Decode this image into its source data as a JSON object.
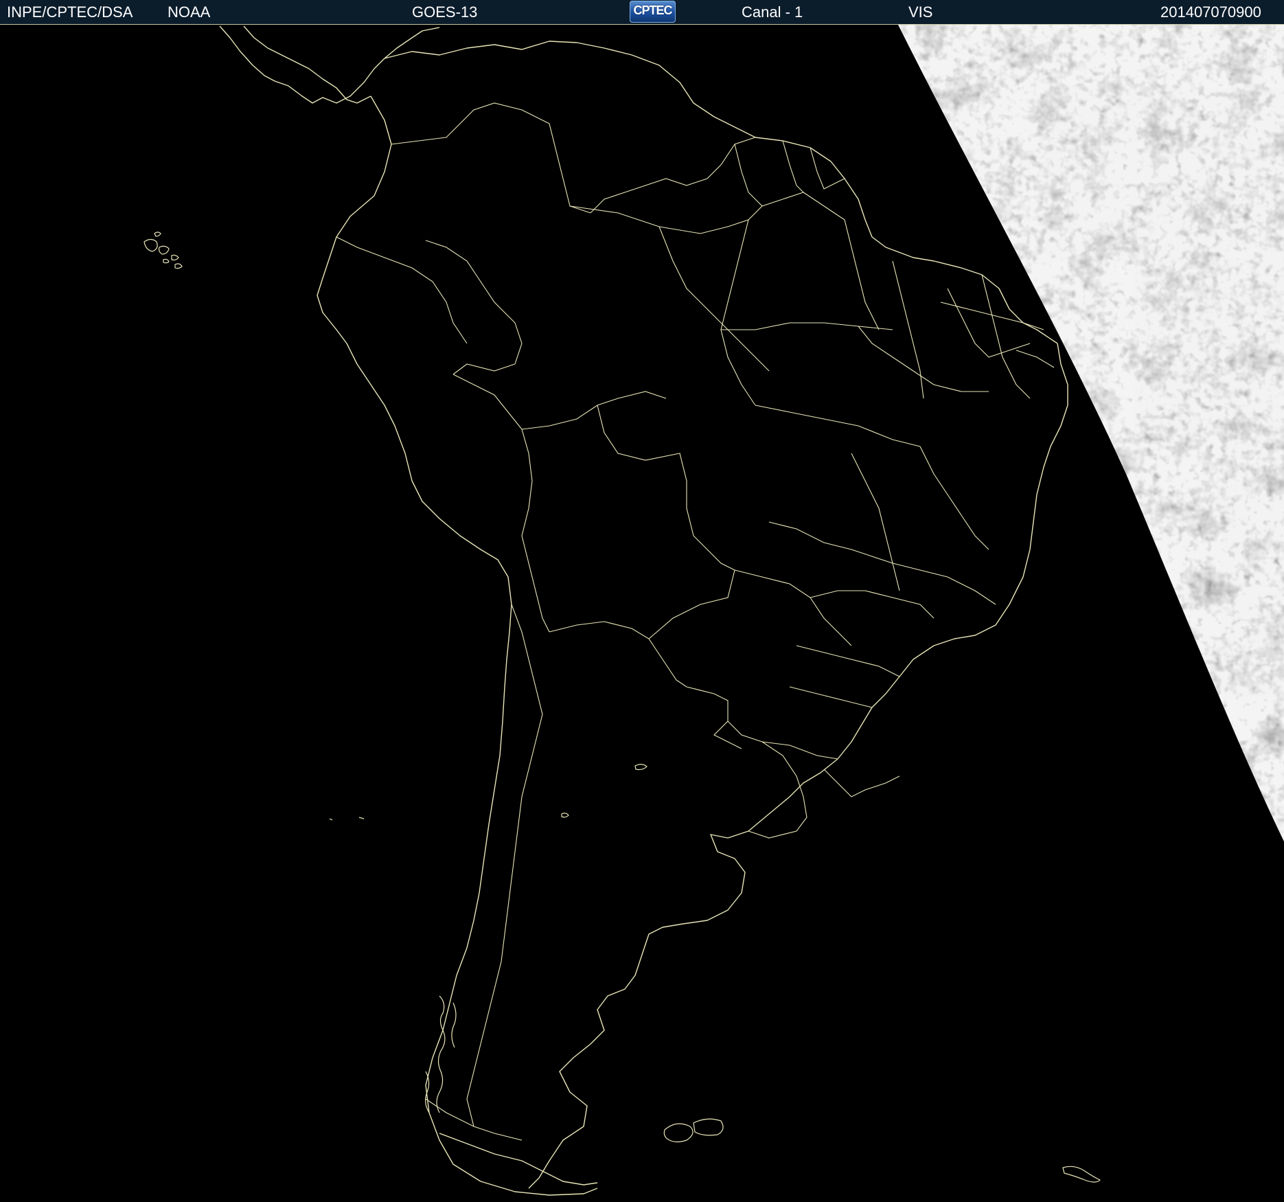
{
  "header": {
    "source": "INPE/CPTEC/DSA",
    "agency": "NOAA",
    "satellite": "GOES-13",
    "logo_text": "CPTEC",
    "channel": "Canal - 1",
    "band": "VIS",
    "timestamp": "201407070900"
  },
  "colors": {
    "background": "#000000",
    "header_background": "#0b1c2b",
    "header_text": "#ffffff",
    "border_lines": "#e8e6b8",
    "cloud_imagery": "#9a9a9a"
  },
  "icons": {
    "logo": "cptec-logo"
  }
}
